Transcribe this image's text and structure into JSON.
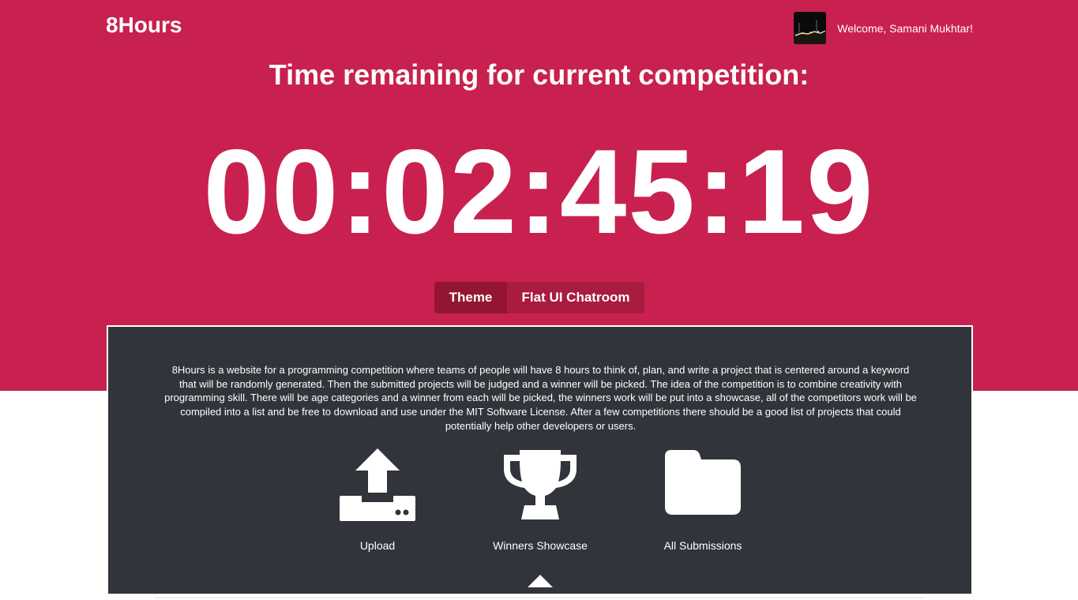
{
  "header": {
    "brand": "8Hours",
    "welcome": "Welcome, Samani Mukhtar!"
  },
  "hero": {
    "heading": "Time remaining for current competition:",
    "timer": "00:02:45:19"
  },
  "tabs": [
    {
      "label": "Theme",
      "active": true
    },
    {
      "label": "Flat UI Chatroom",
      "active": false
    }
  ],
  "panel": {
    "description": "8Hours is a website for a programming competition where teams of people will have 8 hours to think of, plan, and write a project that is centered around a keyword that will be randomly generated. Then the submitted projects will be judged and a winner will be picked. The idea of the competition is to combine creativity with programming skill. There will be age categories and a winner from each will be picked, the winners work will be put into a showcase, all of the competitors work will be compiled into a list and be free to download and use under the MIT Software License. After a few competitions there should be a good list of projects that could potentially help other developers or users.",
    "actions": [
      {
        "label": "Upload",
        "icon": "upload-icon"
      },
      {
        "label": "Winners Showcase",
        "icon": "trophy-icon"
      },
      {
        "label": "All Submissions",
        "icon": "folder-icon"
      }
    ]
  },
  "colors": {
    "hero_bg": "#c8214f",
    "panel_bg": "#32343b",
    "tab_active": "#931532",
    "tab_inactive": "#a91c3f"
  }
}
